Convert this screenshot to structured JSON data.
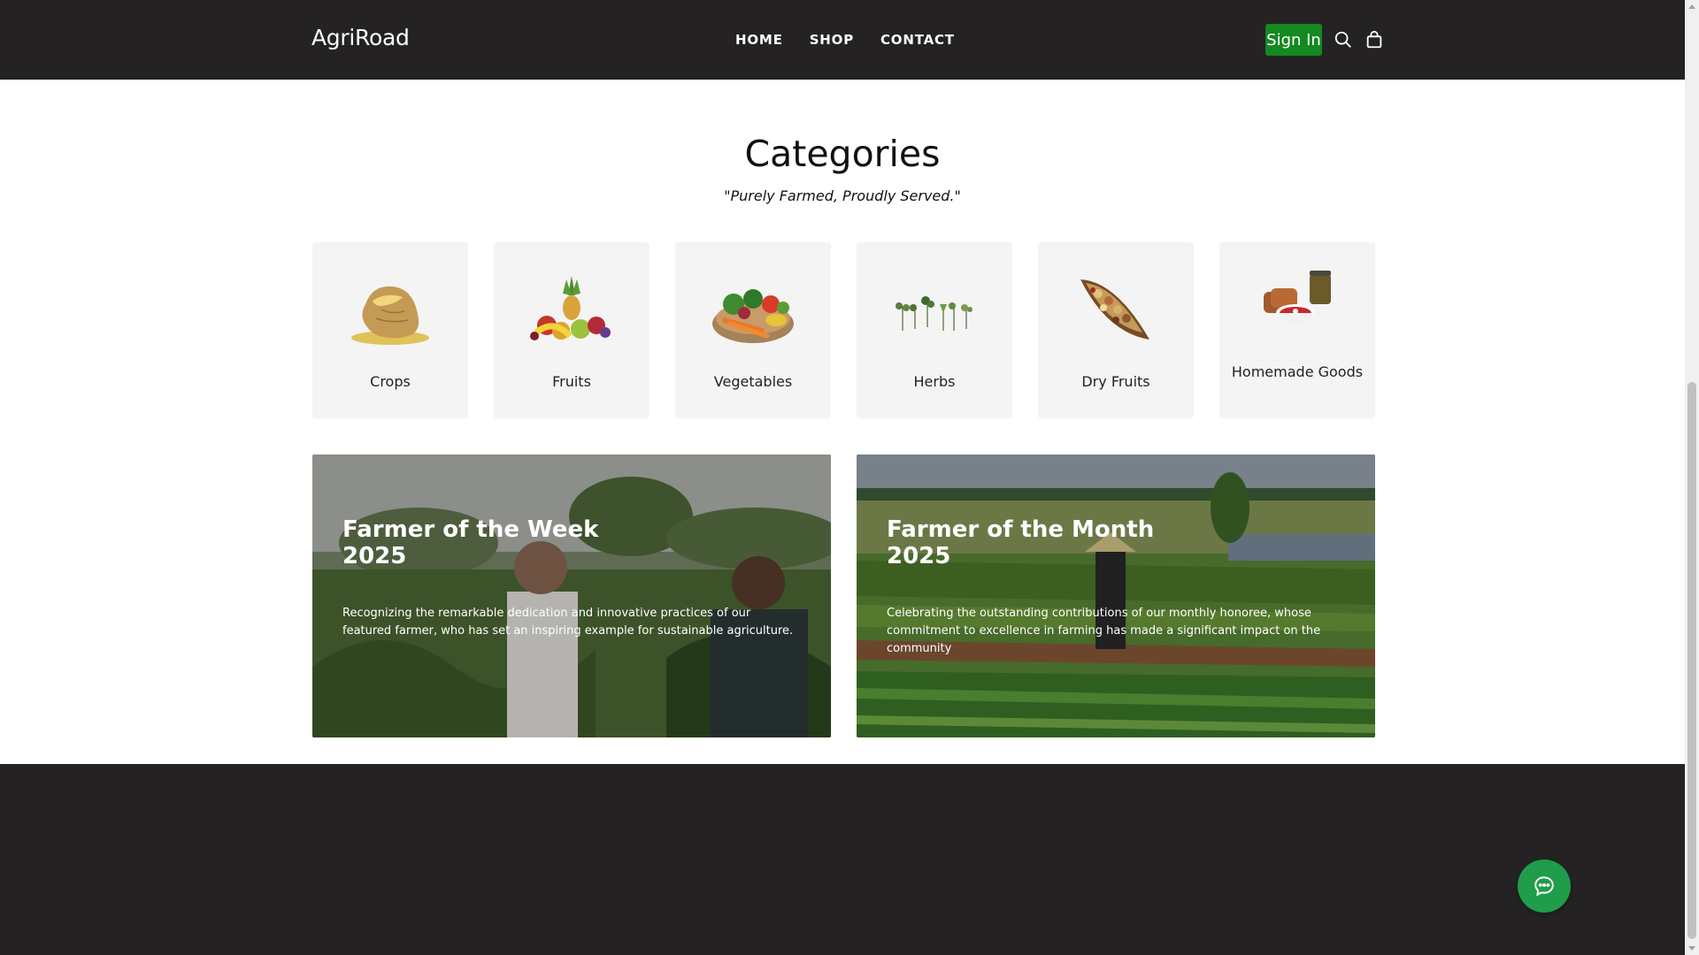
{
  "header": {
    "logo": "AgriRoad",
    "nav": [
      "HOME",
      "SHOP",
      "CONTACT"
    ],
    "sign_in": "Sign In",
    "search_icon": "search-icon",
    "cart_icon": "shopping-bag-icon",
    "brand_green": "#13891f",
    "bar_color": "#252224"
  },
  "categories": {
    "title": "Categories",
    "tagline": "\"Purely Farmed, Proudly Served.\"",
    "items": [
      {
        "label": "Crops"
      },
      {
        "label": "Fruits"
      },
      {
        "label": "Vegetables"
      },
      {
        "label": "Herbs"
      },
      {
        "label": "Dry Fruits"
      },
      {
        "label": "Homemade Goods"
      }
    ]
  },
  "features": [
    {
      "title_line1": "Farmer of the Week",
      "title_line2": "2025",
      "description": "Recognizing the remarkable dedication and innovative practices of our featured farmer, who has set an inspiring example for sustainable agriculture."
    },
    {
      "title_line1": "Farmer of the Month",
      "title_line2": "2025",
      "description": "Celebrating the outstanding contributions of our monthly honoree, whose commitment to excellence in farming has made a significant impact on the community"
    }
  ],
  "chat": {
    "icon": "chat-bubble-icon",
    "color": "#1f9d4a"
  }
}
